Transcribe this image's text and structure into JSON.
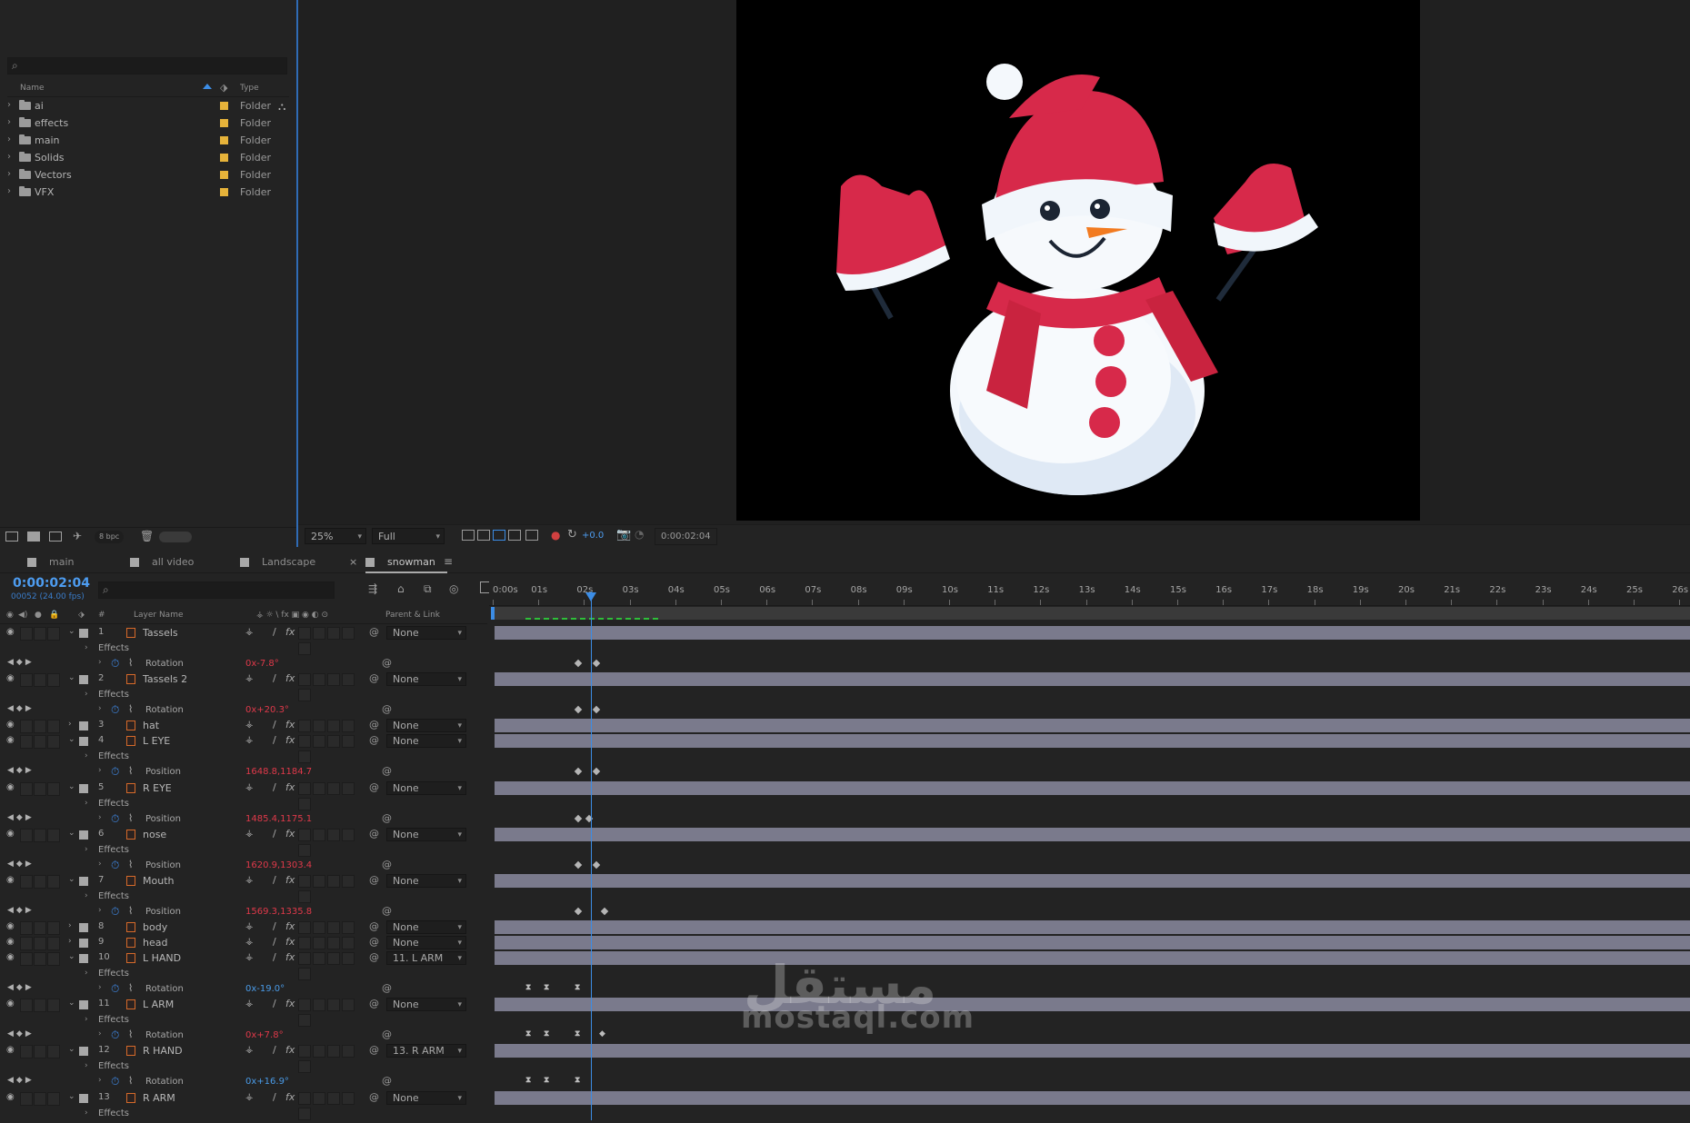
{
  "project": {
    "columns": {
      "name": "Name",
      "type": "Type"
    },
    "items": [
      {
        "name": "ai",
        "type": "Folder"
      },
      {
        "name": "effects",
        "type": "Folder"
      },
      {
        "name": "main",
        "type": "Folder"
      },
      {
        "name": "Solids",
        "type": "Folder"
      },
      {
        "name": "Vectors",
        "type": "Folder"
      },
      {
        "name": "VFX",
        "type": "Folder"
      }
    ],
    "bpc": "8 bpc"
  },
  "viewer": {
    "zoom": "25%",
    "resolution": "Full",
    "exposure": "+0.0",
    "timecode": "0:00:02:04"
  },
  "tabs": [
    {
      "label": "main"
    },
    {
      "label": "all video"
    },
    {
      "label": "Landscape"
    },
    {
      "label": "snowman"
    }
  ],
  "timeline": {
    "timecode": "0:00:02:04",
    "frames": "00052 (24.00 fps)",
    "col_hash": "#",
    "col_layer_name": "Layer Name",
    "col_parent": "Parent & Link",
    "ruler": [
      "0:00s",
      "01s",
      "02s",
      "03s",
      "04s",
      "05s",
      "06s",
      "07s",
      "08s",
      "09s",
      "10s",
      "11s",
      "12s",
      "13s",
      "14s",
      "15s",
      "16s",
      "17s",
      "18s",
      "19s",
      "20s",
      "21s",
      "22s",
      "23s",
      "24s",
      "25s",
      "26s"
    ],
    "effects_label": "Effects",
    "rows": [
      {
        "kind": "layer",
        "num": "1",
        "name": "Tassels",
        "parent": "None",
        "expanded": true
      },
      {
        "kind": "effects"
      },
      {
        "kind": "prop",
        "name": "Rotation",
        "value": "0x-7.8°",
        "color": "#e0394a"
      },
      {
        "kind": "layer",
        "num": "2",
        "name": "Tassels 2",
        "parent": "None",
        "expanded": true
      },
      {
        "kind": "effects"
      },
      {
        "kind": "prop",
        "name": "Rotation",
        "value": "0x+20.3°",
        "color": "#e0394a"
      },
      {
        "kind": "layer",
        "num": "3",
        "name": "hat",
        "parent": "None",
        "expanded": false
      },
      {
        "kind": "layer",
        "num": "4",
        "name": "L EYE",
        "parent": "None",
        "expanded": true
      },
      {
        "kind": "effects"
      },
      {
        "kind": "prop",
        "name": "Position",
        "value": "1648.8,1184.7",
        "color": "#e0394a"
      },
      {
        "kind": "layer",
        "num": "5",
        "name": "R EYE",
        "parent": "None",
        "expanded": true
      },
      {
        "kind": "effects"
      },
      {
        "kind": "prop",
        "name": "Position",
        "value": "1485.4,1175.1",
        "color": "#e0394a"
      },
      {
        "kind": "layer",
        "num": "6",
        "name": "nose",
        "parent": "None",
        "expanded": true
      },
      {
        "kind": "effects"
      },
      {
        "kind": "prop",
        "name": "Position",
        "value": "1620.9,1303.4",
        "color": "#e0394a"
      },
      {
        "kind": "layer",
        "num": "7",
        "name": "Mouth",
        "parent": "None",
        "expanded": true
      },
      {
        "kind": "effects"
      },
      {
        "kind": "prop",
        "name": "Position",
        "value": "1569.3,1335.8",
        "color": "#e0394a"
      },
      {
        "kind": "layer",
        "num": "8",
        "name": "body",
        "parent": "None",
        "expanded": false
      },
      {
        "kind": "layer",
        "num": "9",
        "name": "head",
        "parent": "None",
        "expanded": false
      },
      {
        "kind": "layer",
        "num": "10",
        "name": "L HAND",
        "parent": "11. L ARM",
        "expanded": true
      },
      {
        "kind": "effects"
      },
      {
        "kind": "prop",
        "name": "Rotation",
        "value": "0x-19.0°",
        "color": "#4a9be8"
      },
      {
        "kind": "layer",
        "num": "11",
        "name": "L ARM",
        "parent": "None",
        "expanded": true
      },
      {
        "kind": "effects"
      },
      {
        "kind": "prop",
        "name": "Rotation",
        "value": "0x+7.8°",
        "color": "#e0394a"
      },
      {
        "kind": "layer",
        "num": "12",
        "name": "R HAND",
        "parent": "13. R ARM",
        "expanded": true
      },
      {
        "kind": "effects"
      },
      {
        "kind": "prop",
        "name": "Rotation",
        "value": "0x+16.9°",
        "color": "#4a9be8"
      },
      {
        "kind": "layer",
        "num": "13",
        "name": "R ARM",
        "parent": "None",
        "expanded": true
      },
      {
        "kind": "effects"
      }
    ]
  },
  "watermark": {
    "arabic": "مستقل",
    "latin": "mostaql.com"
  },
  "colors": {
    "accent": "#3c8de6",
    "keyframe_red": "#e0394a",
    "layer_bar": "#7a7a8c",
    "label_yellow": "#e6b33a"
  }
}
